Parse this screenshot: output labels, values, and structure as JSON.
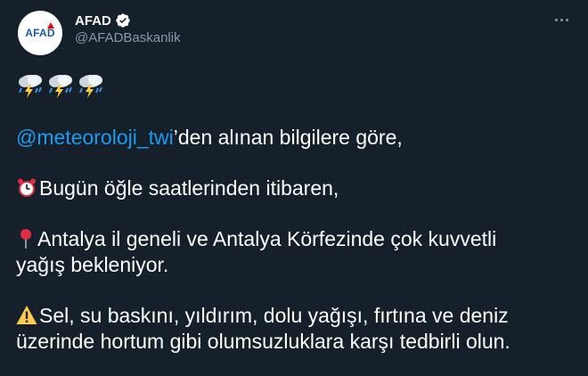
{
  "account": {
    "display_name": "AFAD",
    "handle": "@AFADBaskanlik",
    "avatar_text": "AFAD"
  },
  "icons": {
    "verified": "verified-badge-icon",
    "more": "more-options-icon",
    "storm": "cloud-with-lightning-and-rain-icon",
    "alarm": "alarm-clock-icon",
    "pin": "round-pushpin-icon",
    "warning": "warning-icon"
  },
  "colors": {
    "background": "#15202b",
    "link": "#1d9bf0",
    "secondary_text": "#8b98a5"
  },
  "tweet": {
    "mention": "@meteoroloji_twi",
    "line1_rest": "’den alınan bilgilere göre,",
    "line2": "Bugün öğle saatlerinden itibaren,",
    "line3a": "Antalya il geneli ve Antalya Körfezinde çok kuvvetli",
    "line3b": "yağış bekleniyor.",
    "line4a": "Sel, su baskını, yıldırım, dolu yağışı, fırtına ve deniz",
    "line4b": "üzerinde hortum gibi olumsuzluklara karşı tedbirli olun."
  }
}
